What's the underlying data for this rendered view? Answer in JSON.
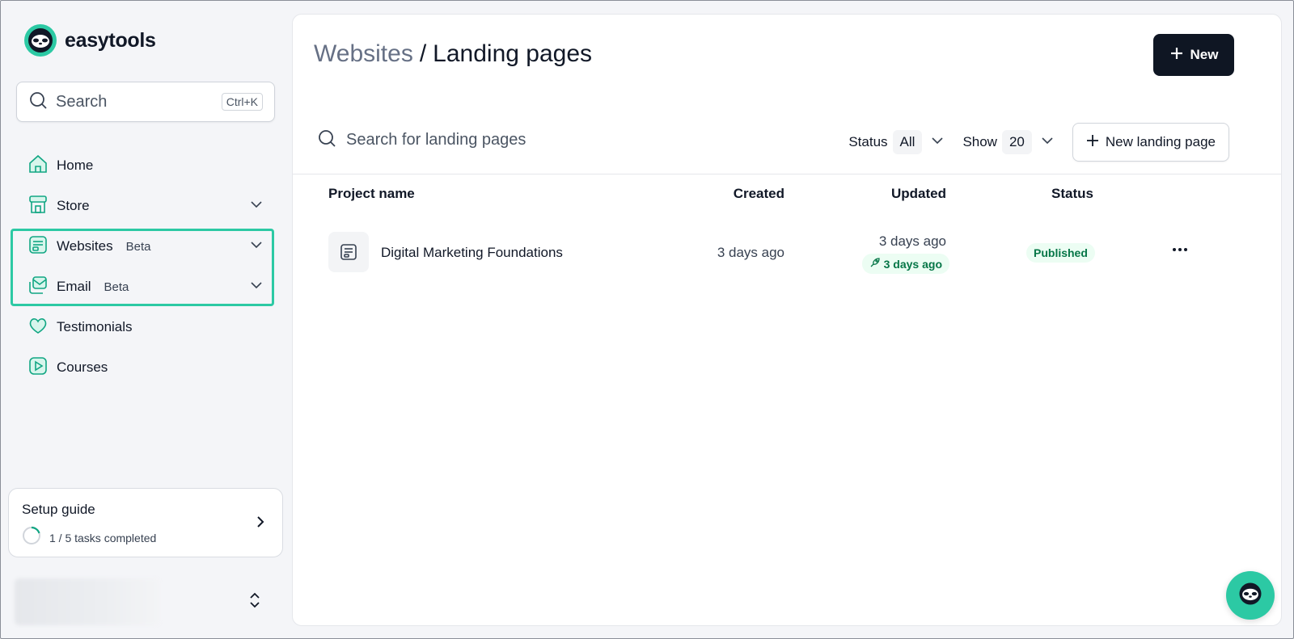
{
  "brand": {
    "name": "easytools",
    "accent": "#2cc9a4"
  },
  "sidebar": {
    "search": {
      "placeholder": "Search",
      "shortcut": "Ctrl+K"
    },
    "items": [
      {
        "label": "Home",
        "icon": "home-icon"
      },
      {
        "label": "Store",
        "icon": "store-icon",
        "expandable": true
      },
      {
        "label": "Websites",
        "badge": "Beta",
        "icon": "websites-icon",
        "expandable": true
      },
      {
        "label": "Email",
        "badge": "Beta",
        "icon": "email-icon",
        "expandable": true
      },
      {
        "label": "Testimonials",
        "icon": "heart-icon"
      },
      {
        "label": "Courses",
        "icon": "play-icon"
      }
    ],
    "setup_guide": {
      "title": "Setup guide",
      "tasks": "1 / 5 tasks completed",
      "progress": 0.2
    }
  },
  "main": {
    "breadcrumb": {
      "parent": "Websites",
      "separator": "/",
      "current": "Landing pages"
    },
    "new_button": "New",
    "search_placeholder": "Search for landing pages",
    "filters": {
      "status": {
        "label": "Status",
        "value": "All"
      },
      "show": {
        "label": "Show",
        "value": "20"
      }
    },
    "new_landing_page_button": "New landing page",
    "table": {
      "columns": [
        "Project name",
        "Created",
        "Updated",
        "Status"
      ],
      "rows": [
        {
          "name": "Digital Marketing Foundations",
          "created": "3 days ago",
          "updated": "3 days ago",
          "published": "3 days ago",
          "status": "Published"
        }
      ]
    }
  }
}
